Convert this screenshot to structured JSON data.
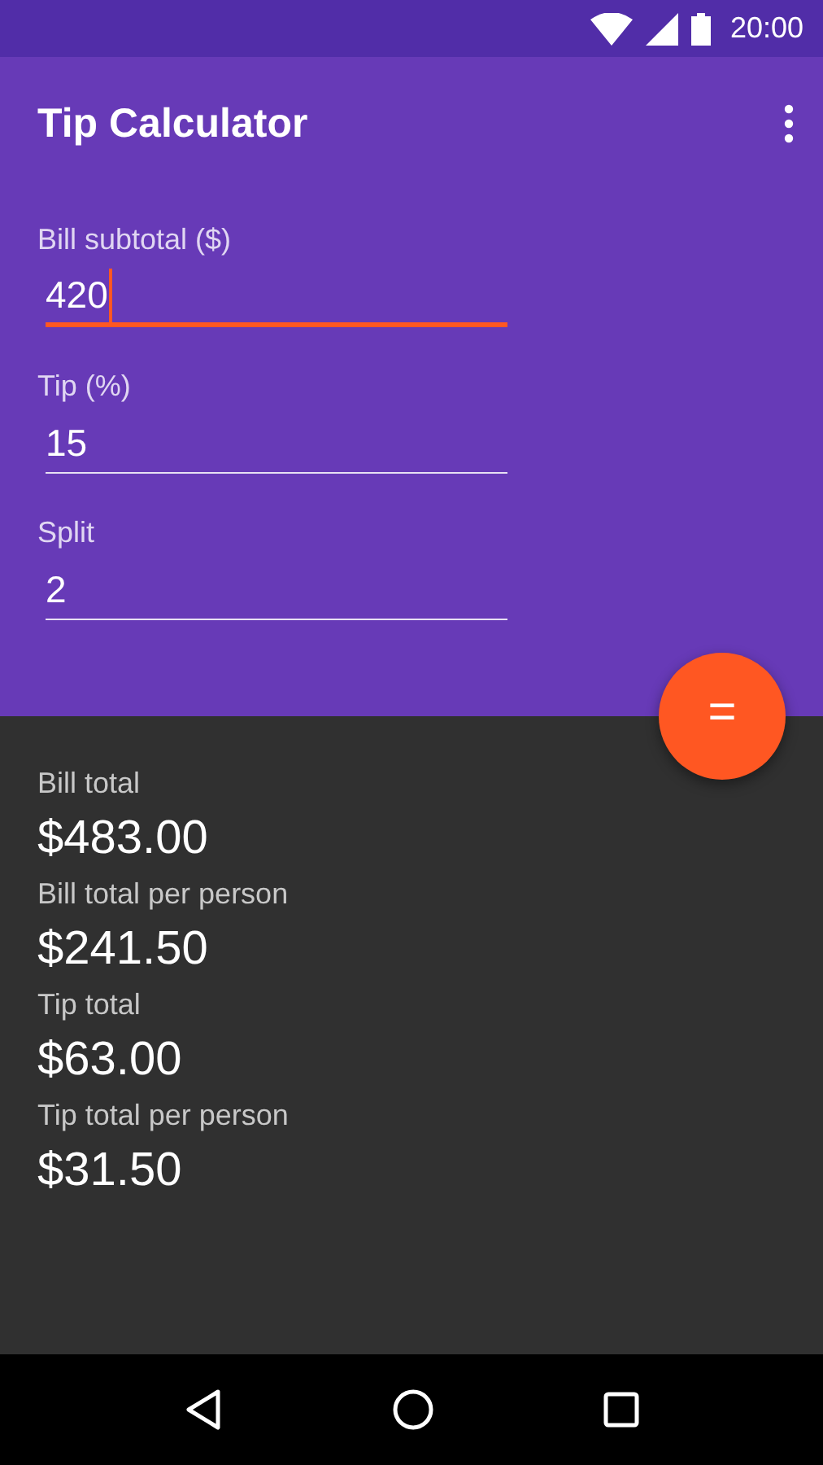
{
  "status_bar": {
    "time": "20:00"
  },
  "app_bar": {
    "title": "Tip Calculator"
  },
  "fields": [
    {
      "label": "Bill subtotal ($)",
      "value": "420",
      "focused": true
    },
    {
      "label": "Tip (%)",
      "value": "15",
      "focused": false
    },
    {
      "label": "Split",
      "value": "2",
      "focused": false
    }
  ],
  "fab": {
    "label": "="
  },
  "results": [
    {
      "label": "Bill total",
      "value": "$483.00"
    },
    {
      "label": "Bill total per person",
      "value": "$241.50"
    },
    {
      "label": "Tip total",
      "value": "$63.00"
    },
    {
      "label": "Tip total per person",
      "value": "$31.50"
    }
  ]
}
